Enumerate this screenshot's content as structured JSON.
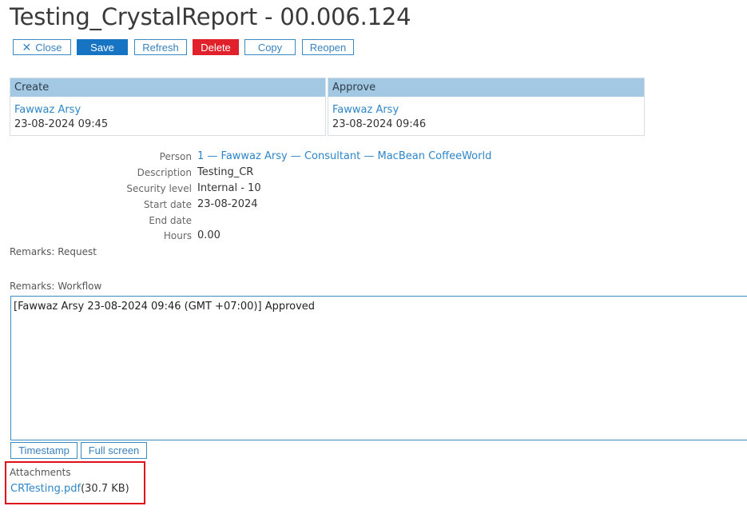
{
  "title": "Testing_CrystalReport - 00.006.124",
  "toolbar": {
    "close_label": "Close",
    "save_label": "Save",
    "refresh_label": "Refresh",
    "delete_label": "Delete",
    "copy_label": "Copy",
    "reopen_label": "Reopen"
  },
  "create": {
    "header": "Create",
    "user": "Fawwaz Arsy",
    "datetime": "23-08-2024 09:45"
  },
  "approve": {
    "header": "Approve",
    "user": "Fawwaz Arsy",
    "datetime": "23-08-2024 09:46"
  },
  "fields": {
    "person": {
      "label": "Person",
      "value": "1 — Fawwaz Arsy — Consultant — MacBean CoffeeWorld"
    },
    "description": {
      "label": "Description",
      "value": "Testing_CR"
    },
    "security_level": {
      "label": "Security level",
      "value": "Internal - 10"
    },
    "start_date": {
      "label": "Start date",
      "value": "23-08-2024"
    },
    "end_date": {
      "label": "End date",
      "value": ""
    },
    "hours": {
      "label": "Hours",
      "value": "0.00"
    }
  },
  "remarks_request": {
    "label": "Remarks: Request"
  },
  "remarks_workflow": {
    "label": "Remarks: Workflow",
    "text": "[Fawwaz Arsy 23-08-2024 09:46 (GMT +07:00)] Approved"
  },
  "workflow_buttons": {
    "timestamp_label": "Timestamp",
    "fullscreen_label": "Full screen"
  },
  "attachments": {
    "label": "Attachments",
    "file_name": "CRTesting.pdf",
    "file_size": "(30.7 KB)"
  },
  "colors": {
    "accent": "#1674c2",
    "danger": "#e0202a",
    "panel_header": "#a3c8e4",
    "link": "#2e86c8",
    "highlight_border": "#e0101a"
  }
}
